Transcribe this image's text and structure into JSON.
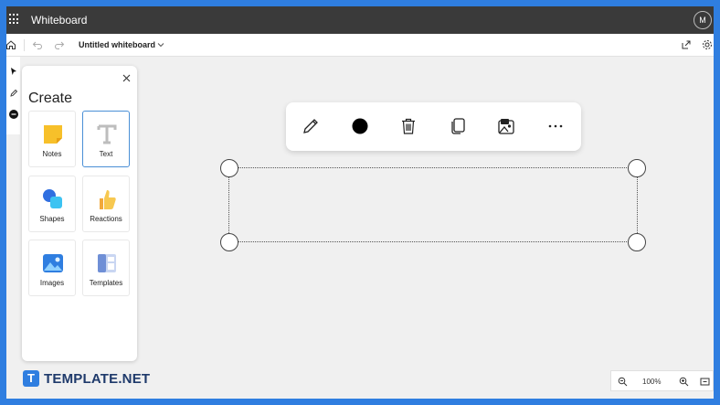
{
  "app": {
    "title": "Whiteboard",
    "user_initial": "M"
  },
  "toolbar": {
    "whiteboard_name": "Untitled whiteboard"
  },
  "panel": {
    "title": "Create",
    "tiles": [
      {
        "label": "Notes",
        "icon": "sticky-note-icon"
      },
      {
        "label": "Text",
        "icon": "text-icon"
      },
      {
        "label": "Shapes",
        "icon": "shapes-icon"
      },
      {
        "label": "Reactions",
        "icon": "thumbs-up-icon"
      },
      {
        "label": "Images",
        "icon": "image-icon"
      },
      {
        "label": "Templates",
        "icon": "templates-icon"
      }
    ],
    "selected_tile": "Text"
  },
  "context_toolbar": {
    "buttons": [
      "pen-icon",
      "color-fill-icon",
      "delete-icon",
      "copy-icon",
      "image-edit-icon",
      "more-icon"
    ],
    "current_color": "#000000"
  },
  "zoom": {
    "level": "100%"
  },
  "branding": {
    "mark": "T",
    "text": "TEMPLATE.NET"
  },
  "colors": {
    "accent": "#2f7ee0",
    "titlebar": "#3a3a3a",
    "canvas": "#f0f0f0"
  }
}
